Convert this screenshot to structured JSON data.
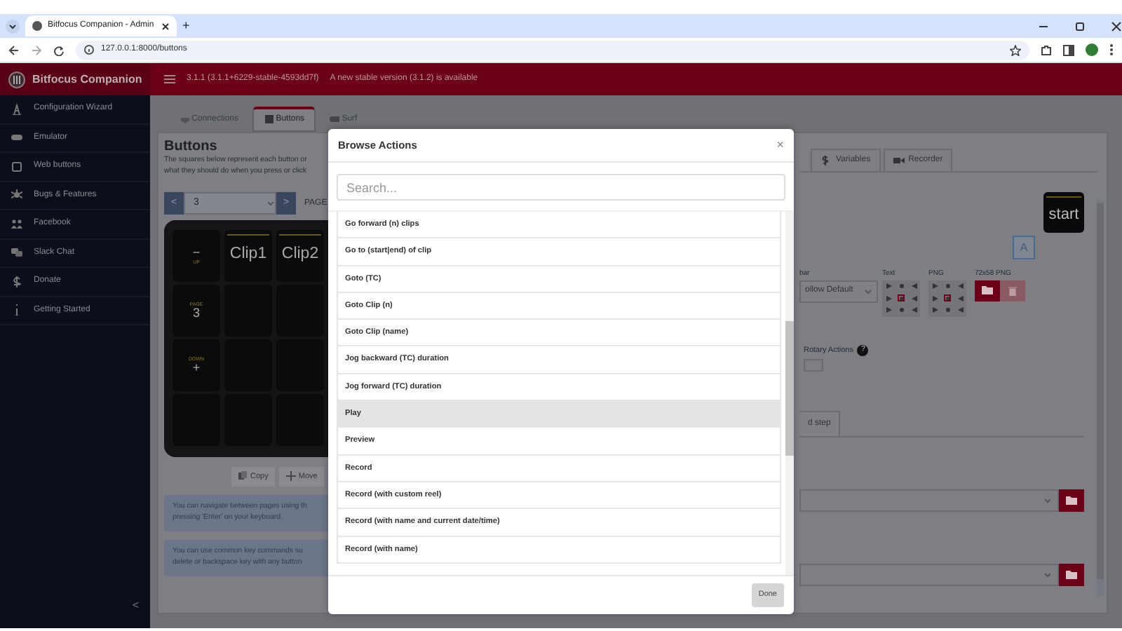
{
  "browser": {
    "tab_title": "Bitfocus Companion - Admin",
    "new_tab": "+",
    "url": "127.0.0.1:8000/buttons"
  },
  "header": {
    "brand": "Bitfocus Companion",
    "version": "3.1.1 (3.1.1+6229-stable-4593dd7f)",
    "notice": "A new stable version (3.1.2) is available"
  },
  "sidebar": {
    "items": [
      {
        "label": "Configuration Wizard"
      },
      {
        "label": "Emulator"
      },
      {
        "label": "Web buttons"
      },
      {
        "label": "Bugs & Features"
      },
      {
        "label": "Facebook"
      },
      {
        "label": "Slack Chat"
      },
      {
        "label": "Donate"
      },
      {
        "label": "Getting Started"
      }
    ],
    "collapse": "<"
  },
  "tabs": [
    {
      "label": "Connections",
      "selected": false
    },
    {
      "label": "Buttons",
      "selected": true
    },
    {
      "label": "Surf",
      "selected": false
    }
  ],
  "buttons_panel": {
    "title": "Buttons",
    "description_lines": [
      "The squares below represent each button or",
      "what they should do when you press or click"
    ],
    "page": {
      "prev": "<",
      "value": "3",
      "next": ">",
      "label": "PAGE"
    },
    "keys": [
      [
        {
          "kind": "symbol_top",
          "symbol": "−",
          "caption": "UP"
        },
        {
          "kind": "clip",
          "text": "Clip1"
        },
        {
          "kind": "clip",
          "text": "Clip2"
        }
      ],
      [
        {
          "kind": "caption_top",
          "caption": "PAGE",
          "symbol": "3"
        },
        {
          "kind": "empty"
        },
        {
          "kind": "empty"
        }
      ],
      [
        {
          "kind": "caption_top",
          "caption": "DOWN",
          "symbol": "+"
        },
        {
          "kind": "empty"
        },
        {
          "kind": "empty"
        }
      ],
      [
        {
          "kind": "empty"
        },
        {
          "kind": "empty"
        },
        {
          "kind": "empty"
        }
      ]
    ],
    "actions": [
      "Copy",
      "Move"
    ],
    "hints": [
      [
        "You can navigate between pages using th",
        "pressing 'Enter' on your keyboard."
      ],
      [
        "You can use common key commands su",
        "delete or backspace key with any button"
      ]
    ]
  },
  "editor": {
    "tabs": [
      "Variables",
      "Recorder"
    ],
    "preview": "start",
    "style_button": "A",
    "labels": [
      "bar",
      "Text",
      "PNG",
      "72x58 PNG"
    ],
    "select_value": "ollow Default",
    "text_align": [
      {
        "selected": false
      },
      {
        "selected": false
      },
      {
        "selected": false
      },
      {
        "selected": false
      },
      {
        "selected": true
      },
      {
        "selected": false
      },
      {
        "selected": false
      },
      {
        "selected": false
      },
      {
        "selected": false
      }
    ],
    "png_align": [
      {
        "selected": false
      },
      {
        "selected": false
      },
      {
        "selected": false
      },
      {
        "selected": false
      },
      {
        "selected": true
      },
      {
        "selected": false
      },
      {
        "selected": false
      },
      {
        "selected": false
      },
      {
        "selected": false
      }
    ],
    "rotary_checked": false,
    "rotary_label": "Rotary Actions",
    "help": "?",
    "step_tab": "d step"
  },
  "modal": {
    "title": "Browse Actions",
    "close": "×",
    "search_placeholder": "Search...",
    "items": [
      {
        "label": "Go forward (n) clips",
        "selected": false
      },
      {
        "label": "Go to (start|end) of clip",
        "selected": false
      },
      {
        "label": "Goto (TC)",
        "selected": false
      },
      {
        "label": "Goto Clip (n)",
        "selected": false
      },
      {
        "label": "Goto Clip (name)",
        "selected": false
      },
      {
        "label": "Jog backward (TC) duration",
        "selected": false
      },
      {
        "label": "Jog forward (TC) duration",
        "selected": false
      },
      {
        "label": "Play",
        "selected": true
      },
      {
        "label": "Preview",
        "selected": false
      },
      {
        "label": "Record",
        "selected": false
      },
      {
        "label": "Record (with custom reel)",
        "selected": false
      },
      {
        "label": "Record (with name and current date/time)",
        "selected": false
      },
      {
        "label": "Record (with name)",
        "selected": false
      }
    ],
    "done": "Done"
  }
}
